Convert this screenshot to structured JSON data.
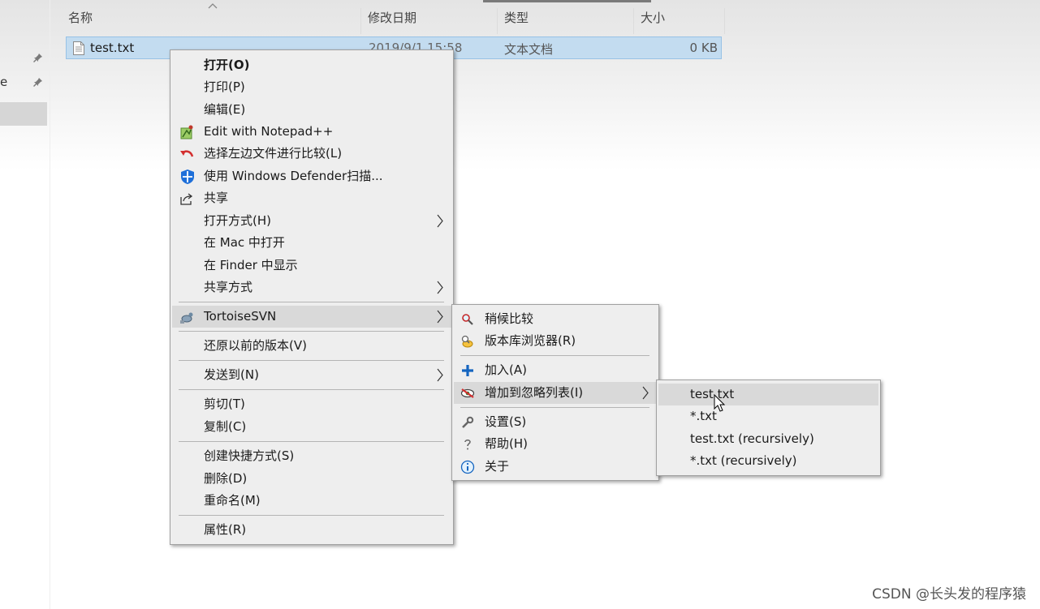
{
  "columns": {
    "name": "名称",
    "date": "修改日期",
    "type": "类型",
    "size": "大小"
  },
  "file": {
    "name": "test.txt",
    "date": "2019/9/1 15:58",
    "type": "文本文档",
    "size": "0 KB"
  },
  "nav": {
    "partial_label": "e"
  },
  "context_menu": {
    "items": {
      "open": "打开(O)",
      "print": "打印(P)",
      "edit": "编辑(E)",
      "notepadpp": "Edit with Notepad++",
      "compare": "选择左边文件进行比较(L)",
      "defender": "使用 Windows Defender扫描...",
      "share": "共享",
      "open_with": "打开方式(H)",
      "open_in_mac": "在 Mac 中打开",
      "show_in_finder": "在 Finder 中显示",
      "share_via": "共享方式",
      "tortoisesvn": "TortoiseSVN",
      "restore": "还原以前的版本(V)",
      "send_to": "发送到(N)",
      "cut": "剪切(T)",
      "copy": "复制(C)",
      "create_shortcut": "创建快捷方式(S)",
      "delete": "删除(D)",
      "rename": "重命名(M)",
      "properties": "属性(R)"
    }
  },
  "svn_menu": {
    "items": {
      "diff_later": "稍候比较",
      "repo_browser": "版本库浏览器(R)",
      "add": "加入(A)",
      "add_to_ignore": "增加到忽略列表(I)",
      "settings": "设置(S)",
      "help": "帮助(H)",
      "about": "关于"
    }
  },
  "ignore_menu": {
    "items": [
      "test.txt",
      "*.txt",
      "test.txt (recursively)",
      "*.txt (recursively)"
    ]
  },
  "watermark": "CSDN @长头发的程序猿",
  "colors": {
    "selection": "#c3dcf0",
    "menu_bg": "#eeeeee",
    "highlight": "#d9d9d9"
  }
}
